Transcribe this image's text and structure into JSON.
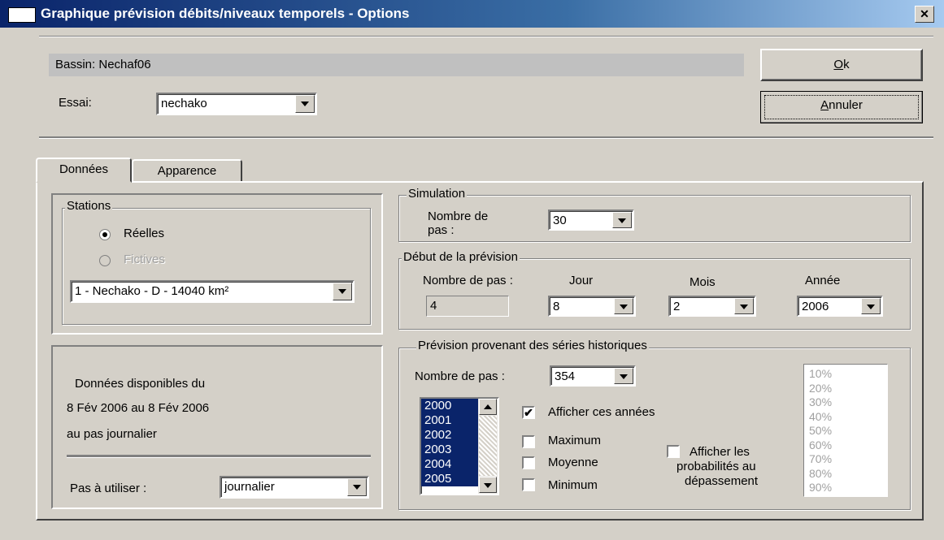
{
  "window": {
    "title": "Graphique prévision débits/niveaux temporels - Options",
    "close_glyph": "✕"
  },
  "header": {
    "bassin_label": "Bassin: Nechaf06",
    "essai_label": "Essai:",
    "essai_value": "nechako",
    "ok_label": "Ok",
    "ok_mnemonic": "O",
    "ok_rest": "k",
    "cancel_mnemonic": "A",
    "cancel_rest": "nnuler"
  },
  "tabs": [
    {
      "label": "Données",
      "active": true
    },
    {
      "label": "Apparence",
      "active": false
    }
  ],
  "stations": {
    "title": "Stations",
    "radio_reelles": "Réelles",
    "radio_fictives": "Fictives",
    "selected_station": "1 - Nechako - D - 14040 km²"
  },
  "available": {
    "line1": "Données disponibles du",
    "line2": "8 Fév 2006 au 8 Fév 2006",
    "line3": "au pas journalier",
    "pas_label": "Pas à utiliser :",
    "pas_value": "journalier"
  },
  "simulation": {
    "title": "Simulation",
    "nombre_label_1": "Nombre de",
    "nombre_label_2": "pas :",
    "nombre_value": "30"
  },
  "debut": {
    "title": "Début de la prévision",
    "nombre_label": "Nombre de pas :",
    "nombre_value": "4",
    "jour_label": "Jour",
    "jour_value": "8",
    "mois_label": "Mois",
    "mois_value": "2",
    "annee_label": "Année",
    "annee_value": "2006"
  },
  "historique": {
    "title": "Prévision provenant des séries historiques",
    "nombre_label": "Nombre de pas :",
    "nombre_value": "354",
    "years": [
      "2000",
      "2001",
      "2002",
      "2003",
      "2004",
      "2005"
    ],
    "afficher_annees": "Afficher ces années",
    "maximum": "Maximum",
    "moyenne": "Moyenne",
    "minimum": "Minimum",
    "proba_1": "Afficher les",
    "proba_2": "probabilités au",
    "proba_3": "dépassement",
    "percentiles": [
      "10%",
      "20%",
      "30%",
      "40%",
      "50%",
      "60%",
      "70%",
      "80%",
      "90%"
    ]
  },
  "colors": {
    "face": "#d4d0c8",
    "title_start": "#0a246a",
    "title_end": "#a6caf0",
    "selection": "#0a246a"
  }
}
